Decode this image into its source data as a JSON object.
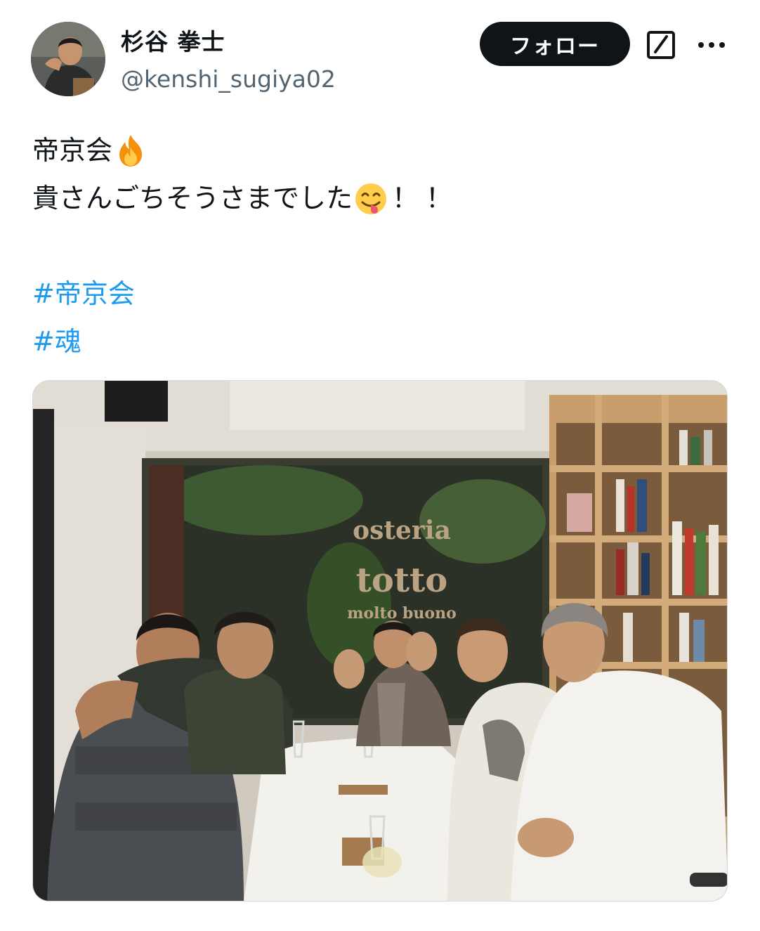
{
  "user": {
    "display_name": "杉谷 拳士",
    "handle": "@kenshi_sugiya02"
  },
  "actions": {
    "follow_label": "フォロー",
    "edit_icon": "grok-edit-icon",
    "more_icon": "more-options-icon"
  },
  "tweet": {
    "line1_text": "帝京会",
    "line1_emoji": "fire-emoji",
    "line2_text": "貴さんごちそうさまでした",
    "line2_emoji": "face-savoring-food-emoji",
    "line2_suffix": "！！",
    "hashtags": [
      "#帝京会",
      "#魂"
    ]
  },
  "media": {
    "photo": "group-photo-restaurant",
    "window_sign": [
      "osteria",
      "totto",
      "molto buono"
    ]
  },
  "colors": {
    "text": "#0f1419",
    "handle": "#536471",
    "hashtag": "#1d9bf0",
    "follow_button_bg": "#0f1419"
  }
}
